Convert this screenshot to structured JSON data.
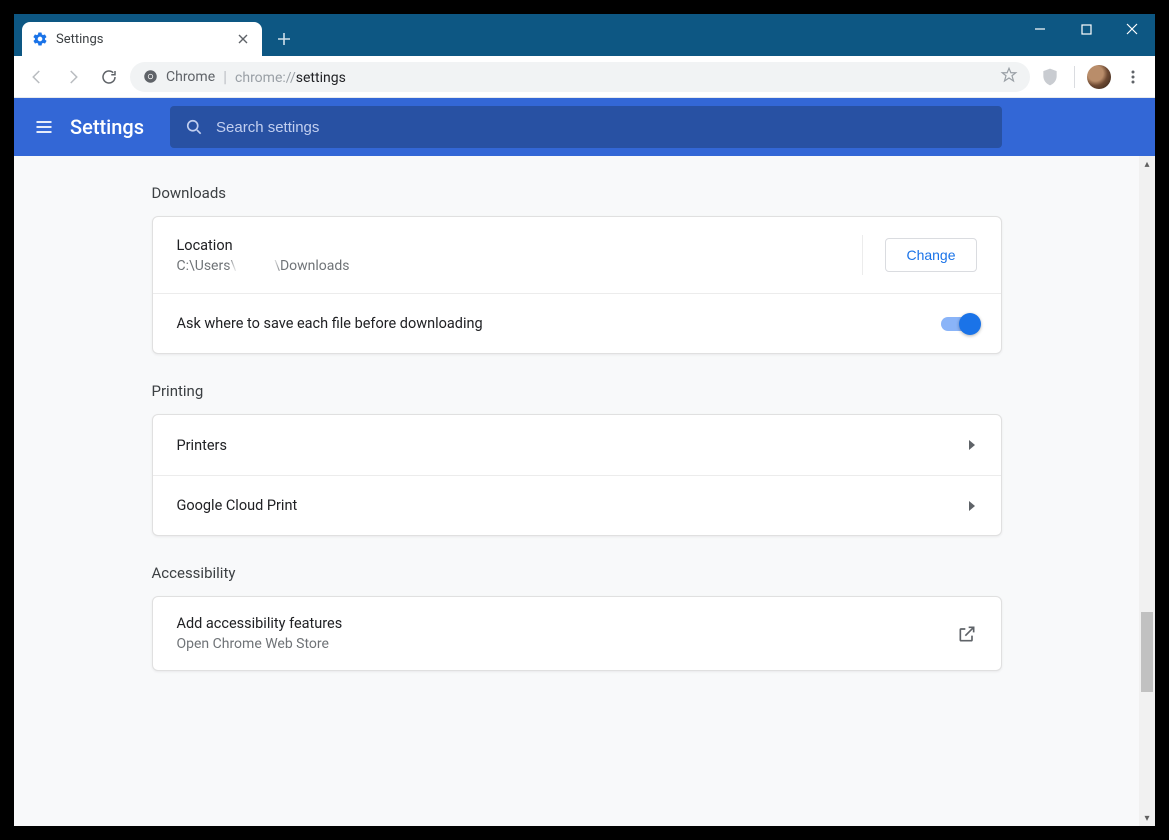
{
  "window": {
    "tab_title": "Settings",
    "omnibox_origin": "Chrome",
    "omnibox_url_prefix": "chrome://",
    "omnibox_url_path": "settings"
  },
  "app_header": {
    "title": "Settings",
    "search_placeholder": "Search settings"
  },
  "sections": {
    "downloads": {
      "header": "Downloads",
      "location_label": "Location",
      "location_prefix": "C:\\Users\\",
      "location_suffix": "\\Downloads",
      "change_button": "Change",
      "ask_label": "Ask where to save each file before downloading",
      "ask_enabled": true
    },
    "printing": {
      "header": "Printing",
      "printers_label": "Printers",
      "gcp_label": "Google Cloud Print"
    },
    "accessibility": {
      "header": "Accessibility",
      "add_label": "Add accessibility features",
      "add_sub": "Open Chrome Web Store"
    }
  }
}
